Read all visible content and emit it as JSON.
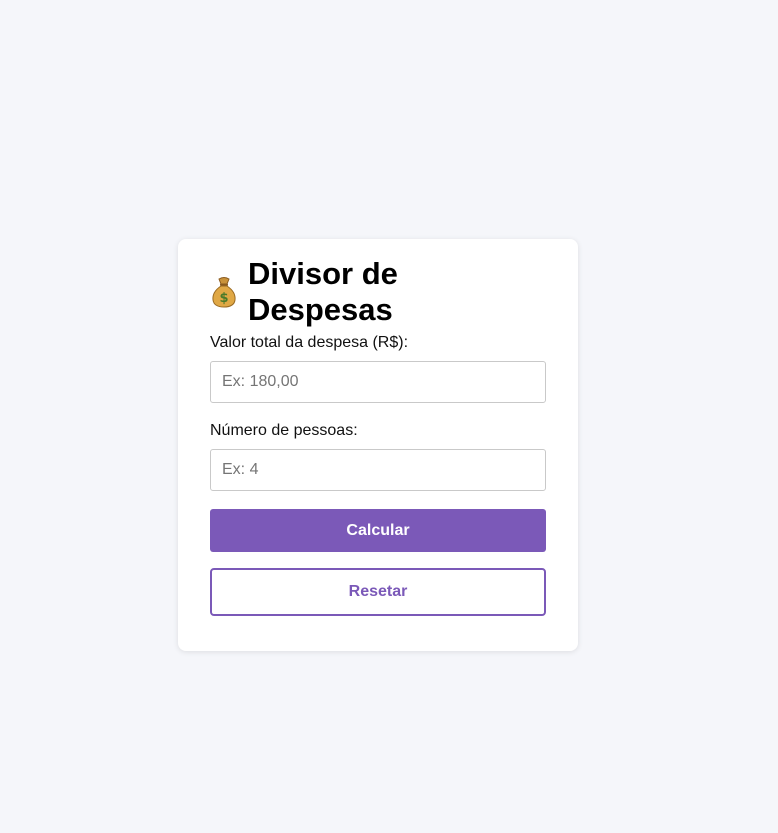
{
  "card": {
    "title": "Divisor de Despesas",
    "title_icon": "money-bag-icon"
  },
  "form": {
    "total_label": "Valor total da despesa (R$):",
    "total_placeholder": "Ex: 180,00",
    "total_value": "",
    "people_label": "Número de pessoas:",
    "people_placeholder": "Ex: 4",
    "people_value": "",
    "calculate_label": "Calcular",
    "reset_label": "Resetar"
  },
  "colors": {
    "accent": "#7b59b8",
    "background": "#f5f6fa",
    "card": "#ffffff"
  }
}
